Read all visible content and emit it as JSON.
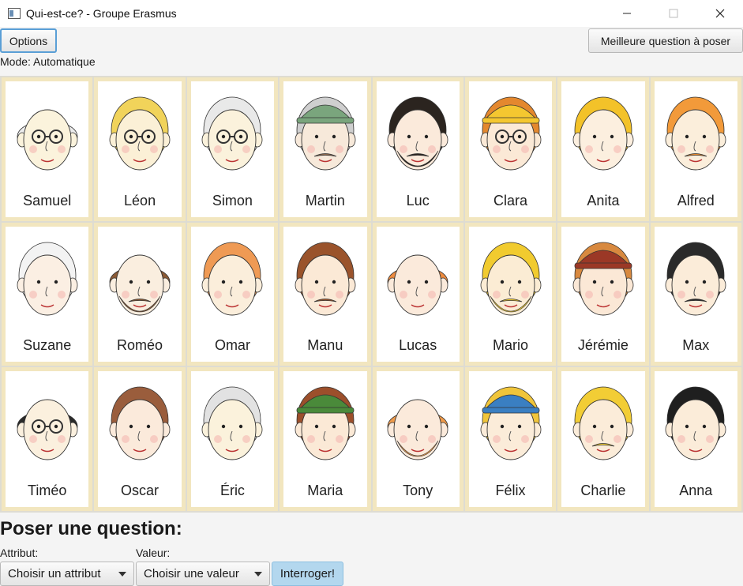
{
  "window": {
    "title": "Qui-est-ce? - Groupe Erasmus"
  },
  "toolbar": {
    "options_label": "Options",
    "best_question_label": "Meilleure question à poser",
    "mode_text": "Mode: Automatique"
  },
  "board": {
    "characters": [
      {
        "name": "Samuel",
        "hair": "#ececec",
        "skin": "#fbf3dc",
        "glasses": true,
        "hat": null,
        "beard": null,
        "mustache": null,
        "bald": true
      },
      {
        "name": "Léon",
        "hair": "#f1d35a",
        "skin": "#fbf0d6",
        "glasses": true,
        "hat": null,
        "beard": null,
        "mustache": null,
        "bald": false
      },
      {
        "name": "Simon",
        "hair": "#e9e9e9",
        "skin": "#fbf2dc",
        "glasses": true,
        "hat": null,
        "beard": null,
        "mustache": null,
        "bald": false
      },
      {
        "name": "Martin",
        "hair": "#cfcfcf",
        "skin": "#f7e9da",
        "glasses": false,
        "hat": "#7aa57d",
        "beard": null,
        "mustache": "#8d6a4f",
        "bald": false
      },
      {
        "name": "Luc",
        "hair": "#2b241f",
        "skin": "#fbeadb",
        "glasses": false,
        "hat": null,
        "beard": "#2b241f",
        "mustache": "#2b241f",
        "bald": false
      },
      {
        "name": "Clara",
        "hair": "#e4882e",
        "skin": "#fbe9d6",
        "glasses": true,
        "hat": "#f4c730",
        "beard": null,
        "mustache": null,
        "bald": false
      },
      {
        "name": "Anita",
        "hair": "#f3c229",
        "skin": "#fcefdf",
        "glasses": false,
        "hat": null,
        "beard": null,
        "mustache": null,
        "bald": false
      },
      {
        "name": "Alfred",
        "hair": "#f29a3a",
        "skin": "#fbeedb",
        "glasses": false,
        "hat": null,
        "beard": null,
        "mustache": "#e98a2c",
        "bald": false
      },
      {
        "name": "Suzane",
        "hair": "#f3f3f3",
        "skin": "#fbefe3",
        "glasses": false,
        "hat": null,
        "beard": null,
        "mustache": null,
        "bald": false
      },
      {
        "name": "Roméo",
        "hair": "#8b5a35",
        "skin": "#faeedf",
        "glasses": false,
        "hat": null,
        "beard": "#8b5a35",
        "mustache": "#8b5a35",
        "bald": true
      },
      {
        "name": "Omar",
        "hair": "#ef9a54",
        "skin": "#fbeedb",
        "glasses": false,
        "hat": null,
        "beard": null,
        "mustache": null,
        "bald": false
      },
      {
        "name": "Manu",
        "hair": "#9a532b",
        "skin": "#fbe9d6",
        "glasses": false,
        "hat": null,
        "beard": null,
        "mustache": "#9a532b",
        "bald": false
      },
      {
        "name": "Lucas",
        "hair": "#ee8b3f",
        "skin": "#fbeadb",
        "glasses": false,
        "hat": null,
        "beard": null,
        "mustache": null,
        "bald": true
      },
      {
        "name": "Mario",
        "hair": "#f1cb2f",
        "skin": "#fbecd4",
        "glasses": false,
        "hat": null,
        "beard": "#f1cb2f",
        "mustache": "#f1cb2f",
        "bald": false
      },
      {
        "name": "Jérémie",
        "hair": "#d8893f",
        "skin": "#fbe8d6",
        "glasses": false,
        "hat": "#9b3826",
        "beard": null,
        "mustache": null,
        "bald": false
      },
      {
        "name": "Max",
        "hair": "#2a2a2a",
        "skin": "#fbecd9",
        "glasses": false,
        "hat": null,
        "beard": null,
        "mustache": "#2a2a2a",
        "bald": false
      },
      {
        "name": "Timéo",
        "hair": "#2a2a2a",
        "skin": "#fbf0de",
        "glasses": true,
        "hat": null,
        "beard": null,
        "mustache": null,
        "bald": true
      },
      {
        "name": "Oscar",
        "hair": "#9a5d3c",
        "skin": "#fbeadb",
        "glasses": false,
        "hat": null,
        "beard": null,
        "mustache": null,
        "bald": false
      },
      {
        "name": "Éric",
        "hair": "#e2e2e2",
        "skin": "#fbf2dc",
        "glasses": false,
        "hat": null,
        "beard": null,
        "mustache": null,
        "bald": false
      },
      {
        "name": "Maria",
        "hair": "#9c4f2b",
        "skin": "#fbe9d6",
        "glasses": false,
        "hat": "#4a8a3a",
        "beard": null,
        "mustache": null,
        "bald": false
      },
      {
        "name": "Tony",
        "hair": "#ef9a4a",
        "skin": "#fbeadb",
        "glasses": false,
        "hat": null,
        "beard": "#ef9a4a",
        "mustache": null,
        "bald": true
      },
      {
        "name": "Félix",
        "hair": "#f0c53a",
        "skin": "#fbecd9",
        "glasses": false,
        "hat": "#3a7fc2",
        "beard": null,
        "mustache": null,
        "bald": false
      },
      {
        "name": "Charlie",
        "hair": "#f2cd35",
        "skin": "#fbecd9",
        "glasses": false,
        "hat": null,
        "beard": null,
        "mustache": "#f2cd35",
        "bald": false
      },
      {
        "name": "Anna",
        "hair": "#1f1f1f",
        "skin": "#fbecd9",
        "glasses": false,
        "hat": null,
        "beard": null,
        "mustache": null,
        "bald": false
      }
    ]
  },
  "question": {
    "heading": "Poser une question:",
    "attribute_label": "Attribut:",
    "value_label": "Valeur:",
    "attribute_placeholder": "Choisir un attribut",
    "value_placeholder": "Choisir une valeur",
    "ask_label": "Interroger!"
  },
  "colors": {
    "accent": "#5a9fd6",
    "ask_button": "#b3d7ee",
    "card_border": "#f2e6bf"
  }
}
